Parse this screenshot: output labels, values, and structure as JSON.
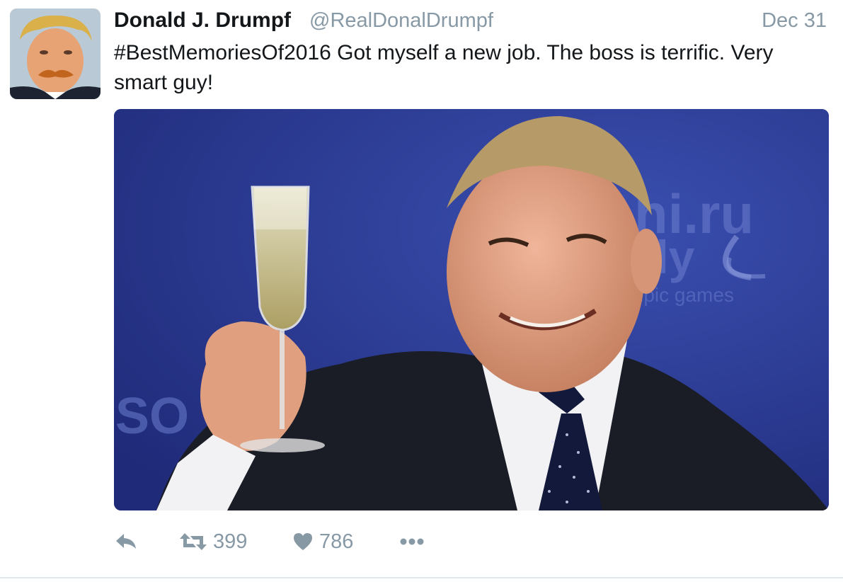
{
  "tweet": {
    "display_name": "Donald J. Drumpf",
    "handle": "@RealDonalDrumpf",
    "timestamp": "Dec 31",
    "text": "#BestMemoriesOf2016 Got myself a new job. The boss is terrific. Very smart guy!",
    "media": {
      "background_text_1": "hi.ru",
      "background_text_2": "oly",
      "background_text_3": "mpic games",
      "background_text_4": "SO"
    }
  },
  "actions": {
    "reply_icon": "reply-icon",
    "retweet_icon": "retweet-icon",
    "retweet_count": "399",
    "like_icon": "heart-icon",
    "like_count": "786",
    "more_icon": "more-icon"
  },
  "colors": {
    "text": "#14171a",
    "secondary": "#8899a6",
    "divider": "#e1e8ed",
    "media_background": "#2b3a8c"
  }
}
